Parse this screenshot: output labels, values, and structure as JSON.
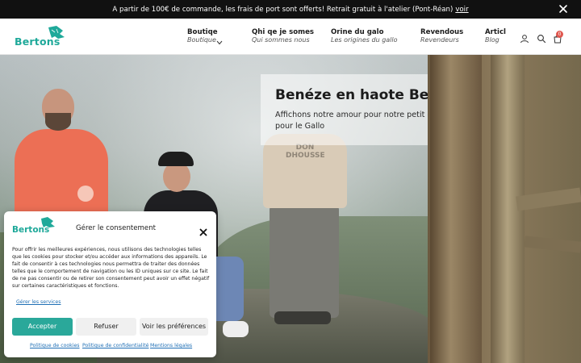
{
  "announcement": {
    "text": "A partir de 100€ de commande, les frais de port sont offerts! Retrait gratuit à l'atelier (Pont-Réan)",
    "link_label": "voir"
  },
  "brand": {
    "logo_text": "Bertons",
    "accent": "#1fa99a"
  },
  "nav": {
    "items": [
      {
        "title": "Boutiqe",
        "subtitle": "Boutique"
      },
      {
        "title": "Qhi qe je somes",
        "subtitle": "Qui sommes nous"
      },
      {
        "title": "Orine du galo",
        "subtitle": "Les origines du gallo"
      },
      {
        "title": "Revendous",
        "subtitle": "Revendeurs"
      },
      {
        "title": "Articl",
        "subtitle": "Blog"
      }
    ],
    "cart_count": "0"
  },
  "hero": {
    "title": "Benéze en haote Bertè",
    "subtitle": "Affichons notre amour pour notre petit coin",
    "subtitle_2": "pour le Gallo",
    "shirt_print": "DON DHOUSSE"
  },
  "consent": {
    "logo_text": "Bertons",
    "title": "Gérer le consentement",
    "body": "Pour offrir les meilleures expériences, nous utilisons des technologies telles que les cookies pour stocker et/ou accéder aux informations des appareils. Le fait de consentir à ces technologies nous permettra de traiter des données telles que le comportement de navigation ou les ID uniques sur ce site. Le fait de ne pas consentir ou de retirer son consentement peut avoir un effet négatif sur certaines caractéristiques et fonctions.",
    "services_link": "Gérer les services",
    "accept_label": "Accepter",
    "refuse_label": "Refuser",
    "prefs_label": "Voir les préférences",
    "links": [
      "Politique de cookies",
      "Politique de confidentialité",
      "Mentions légales"
    ],
    "accept_color": "#2aa89a"
  }
}
